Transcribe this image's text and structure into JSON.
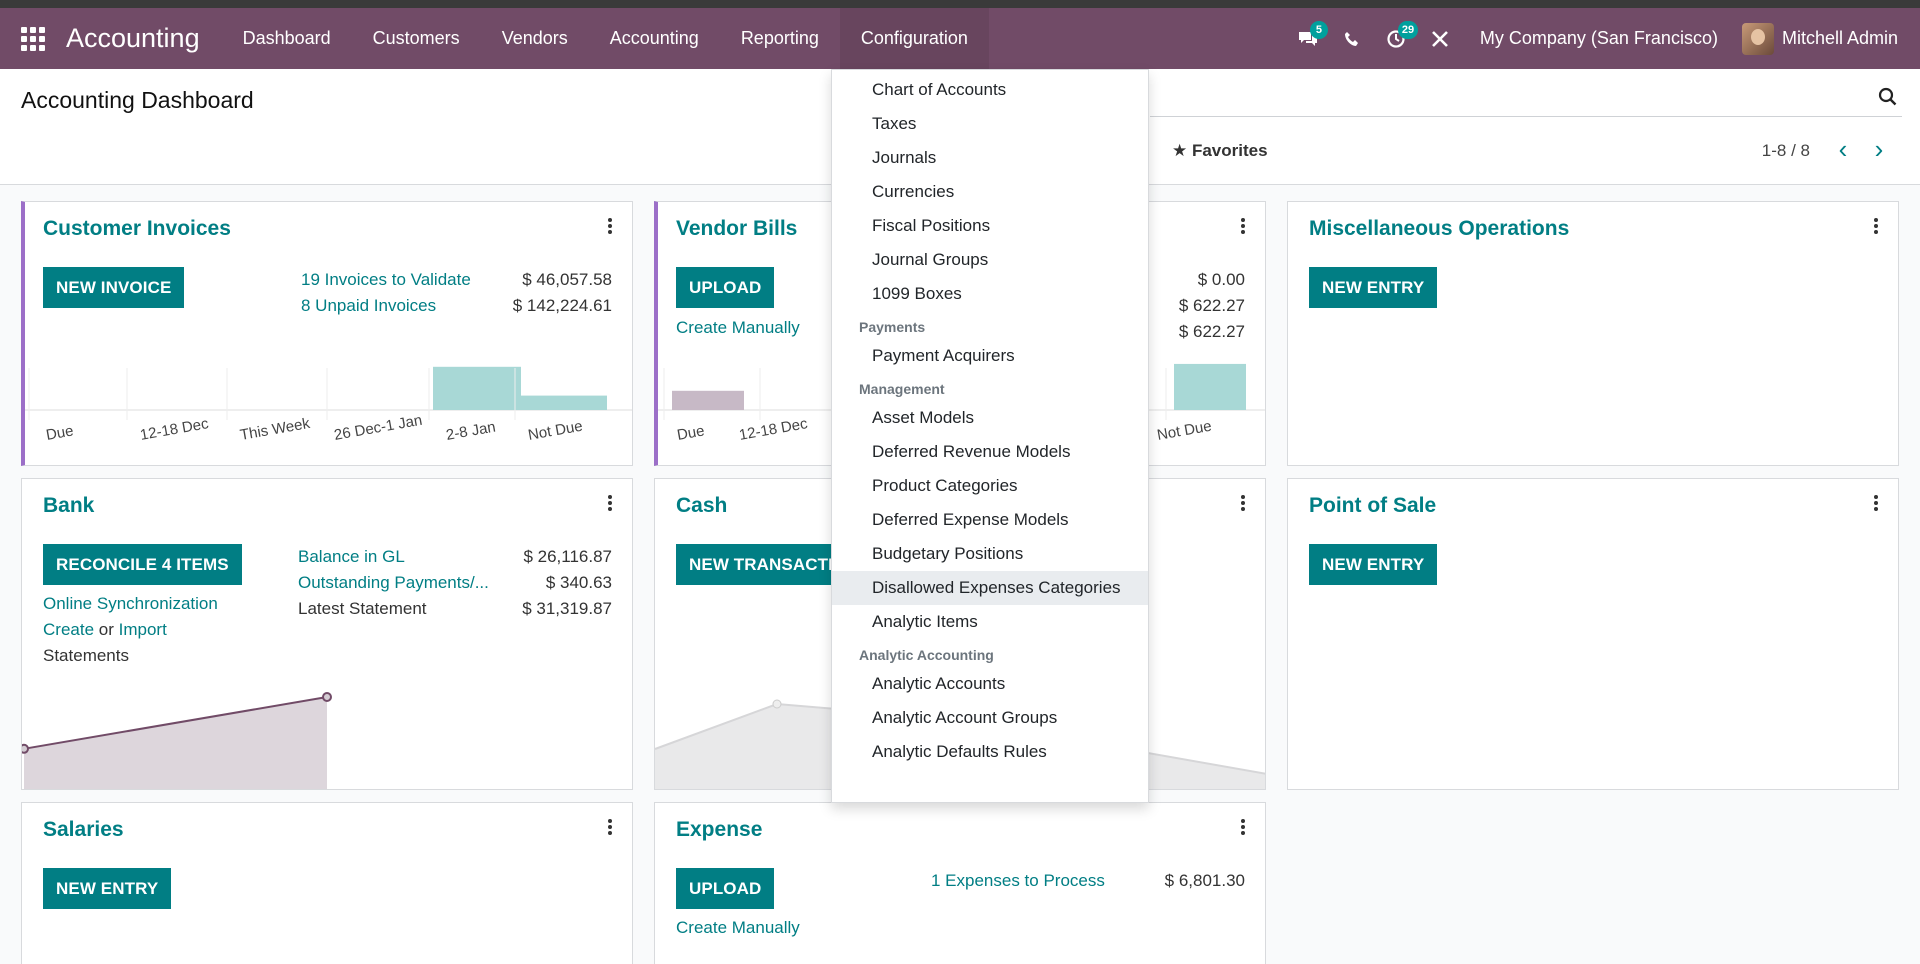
{
  "navbar": {
    "app_name": "Accounting",
    "menus": [
      "Dashboard",
      "Customers",
      "Vendors",
      "Accounting",
      "Reporting",
      "Configuration"
    ],
    "active_menu": "Configuration",
    "messages_badge": "5",
    "activities_badge": "29",
    "company": "My Company (San Francisco)",
    "user": "Mitchell Admin",
    "bar_color": "#714b67"
  },
  "control_panel": {
    "title": "Accounting Dashboard",
    "favorites": "Favorites",
    "pager": "1-8 / 8"
  },
  "cards": {
    "customer_invoices": {
      "title": "Customer Invoices",
      "button": "NEW INVOICE",
      "lines": [
        {
          "label": "19 Invoices to Validate",
          "amount": "$ 46,057.58"
        },
        {
          "label": "8 Unpaid Invoices",
          "amount": "$ 142,224.61"
        }
      ]
    },
    "vendor_bills": {
      "title": "Vendor Bills",
      "button": "UPLOAD",
      "link": "Create Manually",
      "amounts": [
        "$ 0.00",
        "$ 622.27",
        "$ 622.27"
      ]
    },
    "misc": {
      "title": "Miscellaneous Operations",
      "button": "NEW ENTRY"
    },
    "bank": {
      "title": "Bank",
      "button": "RECONCILE 4 ITEMS",
      "online_sync": "Online Synchronization",
      "create": "Create",
      "or": "or",
      "import": "Import",
      "statements": "Statements",
      "lines": [
        {
          "label": "Balance in GL",
          "amount": "$ 26,116.87"
        },
        {
          "label": "Outstanding Payments/...",
          "amount": "$ 340.63"
        },
        {
          "label": "Latest Statement",
          "amount": "$ 31,319.87"
        }
      ]
    },
    "cash": {
      "title": "Cash",
      "button": "NEW TRANSACTIO"
    },
    "pos": {
      "title": "Point of Sale",
      "button": "NEW ENTRY"
    },
    "salaries": {
      "title": "Salaries",
      "button": "NEW ENTRY"
    },
    "expense": {
      "title": "Expense",
      "button": "UPLOAD",
      "link": "Create Manually",
      "line": {
        "label": "1 Expenses to Process",
        "amount": "$ 6,801.30"
      }
    }
  },
  "chart_data": [
    {
      "type": "bar",
      "categories": [
        "Due",
        "12-18 Dec",
        "This Week",
        "26 Dec-1 Jan",
        "2-8 Jan",
        "Not Due"
      ],
      "values": [
        0,
        0,
        0,
        0,
        36,
        12
      ],
      "colors": {
        "past": "#c7b9c6",
        "future": "#a8d8d6"
      }
    },
    {
      "type": "bar",
      "categories": [
        "Due",
        "12-18 Dec",
        "Not Due"
      ],
      "values": [
        20,
        0,
        48
      ],
      "colors": {
        "past": "#c7b9c6",
        "future": "#a8d8d6"
      }
    },
    {
      "type": "area",
      "values": [
        0.3,
        1.0
      ],
      "color": "#714b67"
    }
  ],
  "dropdown": {
    "items_top": [
      "Chart of Accounts",
      "Taxes",
      "Journals",
      "Currencies",
      "Fiscal Positions",
      "Journal Groups",
      "1099 Boxes"
    ],
    "payments_header": "Payments",
    "payments_items": [
      "Payment Acquirers"
    ],
    "management_header": "Management",
    "management_items": [
      "Asset Models",
      "Deferred Revenue Models",
      "Product Categories",
      "Deferred Expense Models",
      "Budgetary Positions",
      "Disallowed Expenses Categories",
      "Analytic Items"
    ],
    "analytic_header": "Analytic Accounting",
    "analytic_items": [
      "Analytic Accounts",
      "Analytic Account Groups",
      "Analytic Defaults Rules"
    ],
    "hovered": "Disallowed Expenses Categories"
  }
}
